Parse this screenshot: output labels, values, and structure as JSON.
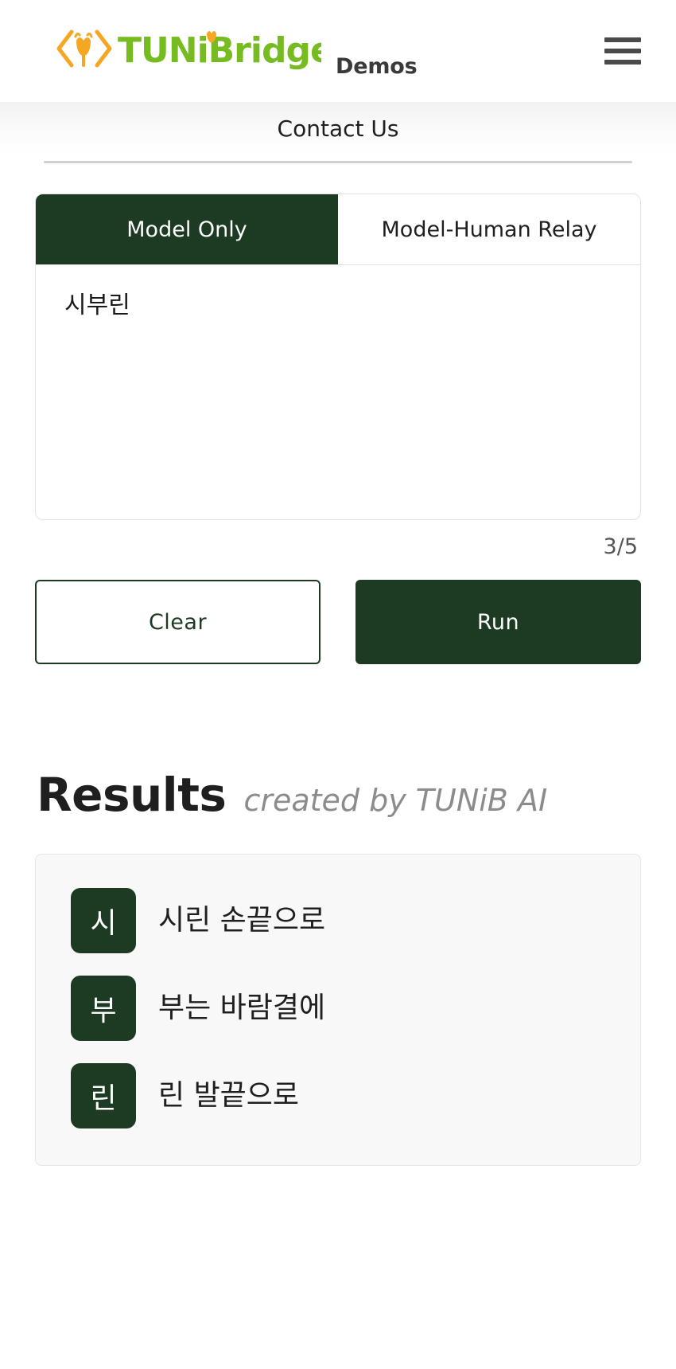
{
  "header": {
    "logo_text_primary": "TUNi",
    "logo_text_secondary": "Bridge",
    "logo_bracket_left": "⟨",
    "logo_bracket_right": "⟩",
    "section_label": "Demos",
    "menu_icon": "hamburger-menu-icon",
    "colors": {
      "logo_green": "#76bc21",
      "logo_orange": "#f5a623",
      "menu_gray": "#4a4a4a"
    }
  },
  "nav": {
    "contact_label": "Contact Us"
  },
  "tabs": [
    {
      "label": "Model Only",
      "active": true
    },
    {
      "label": "Model-Human Relay",
      "active": false
    }
  ],
  "input": {
    "value": "시부린",
    "placeholder": "",
    "counter": "3/5"
  },
  "actions": {
    "clear_label": "Clear",
    "run_label": "Run"
  },
  "results": {
    "title": "Results",
    "subtitle": "created by TUNiB AI",
    "rows": [
      {
        "syllable": "시",
        "line": "시린 손끝으로"
      },
      {
        "syllable": "부",
        "line": "부는 바람결에"
      },
      {
        "syllable": "린",
        "line": "린 발끝으로"
      }
    ]
  },
  "theme": {
    "brand_dark_green": "#1c3b22",
    "card_bg": "#f7f8f7",
    "border_gray": "#e2e2e2"
  }
}
